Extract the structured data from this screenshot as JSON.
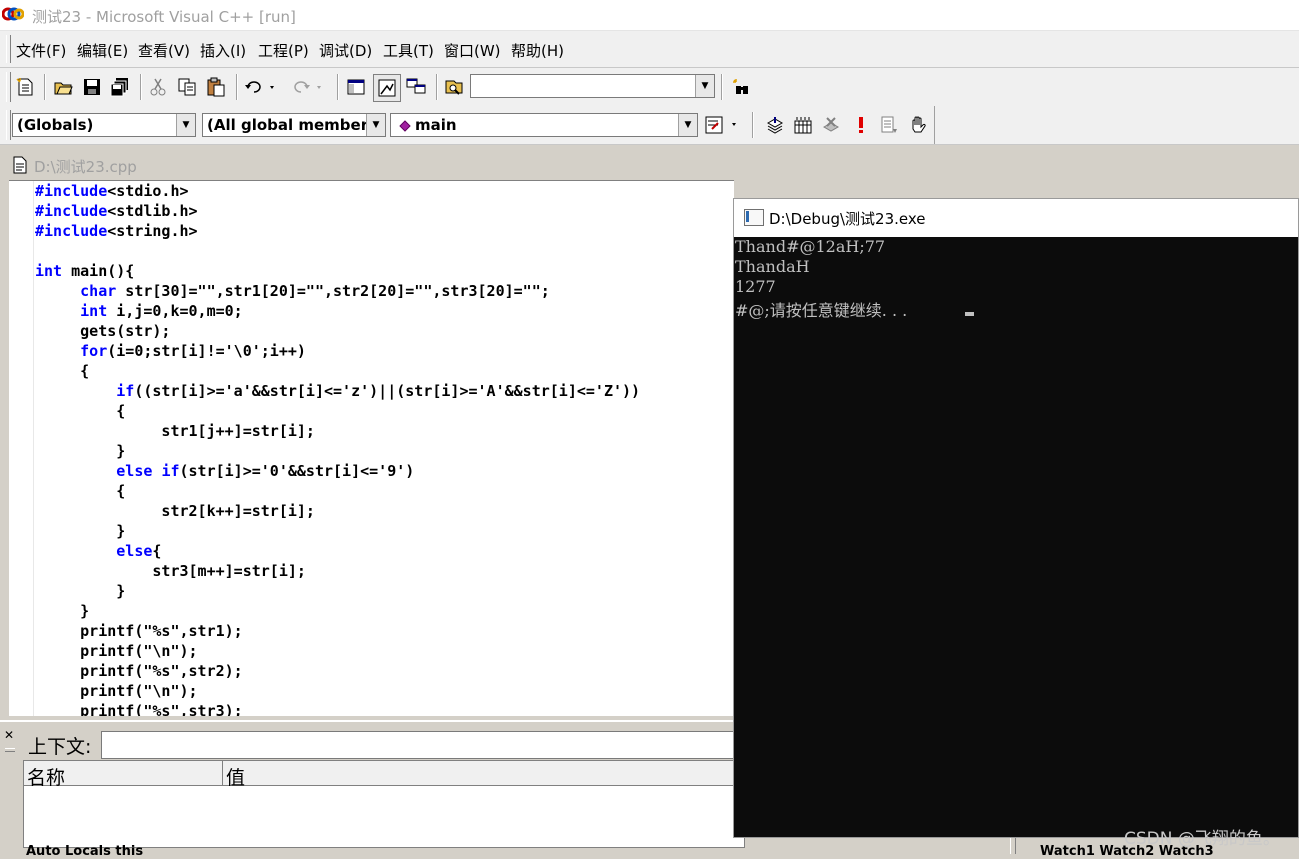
{
  "window": {
    "title": "测试23 - Microsoft Visual C++ [run]"
  },
  "menu": [
    "文件(F)",
    "编辑(E)",
    "查看(V)",
    "插入(I)",
    "工程(P)",
    "调试(D)",
    "工具(T)",
    "窗口(W)",
    "帮助(H)"
  ],
  "toolbar": {
    "find_value": "",
    "scope_combo": "(Globals)",
    "members_combo": "(All global members",
    "function_combo": "main"
  },
  "editor": {
    "file_title": "D:\\测试23.cpp",
    "lines": [
      "#include<stdio.h>",
      "#include<stdlib.h>",
      "#include<string.h>",
      "",
      "int main(){",
      "     char str[30]=\"\",str1[20]=\"\",str2[20]=\"\",str3[20]=\"\";",
      "     int i,j=0,k=0,m=0;",
      "     gets(str);",
      "     for(i=0;str[i]!='\\0';i++)",
      "     {",
      "         if((str[i]>='a'&&str[i]<='z')||(str[i]>='A'&&str[i]<='Z'))",
      "         {",
      "              str1[j++]=str[i];",
      "         }",
      "         else if(str[i]>='0'&&str[i]<='9')",
      "         {",
      "              str2[k++]=str[i];",
      "         }",
      "         else{",
      "             str3[m++]=str[i];",
      "         }",
      "     }",
      "     printf(\"%s\",str1);",
      "     printf(\"\\n\");",
      "     printf(\"%s\",str2);",
      "     printf(\"\\n\");",
      "     printf(\"%s\",str3);"
    ]
  },
  "debug_pane": {
    "context_label": "上下文:",
    "col_name": "名称",
    "col_value": "值",
    "left_tabs": "Auto  Locals  this",
    "right_tabs": "Watch1  Watch2  Watch3"
  },
  "console": {
    "title": "D:\\Debug\\测试23.exe",
    "lines": [
      "Thand#@12aH;77",
      "ThandaH",
      "1277",
      "#@;请按任意键继续. . . "
    ]
  },
  "watermark": "CSDN @飞翔的鱼。"
}
